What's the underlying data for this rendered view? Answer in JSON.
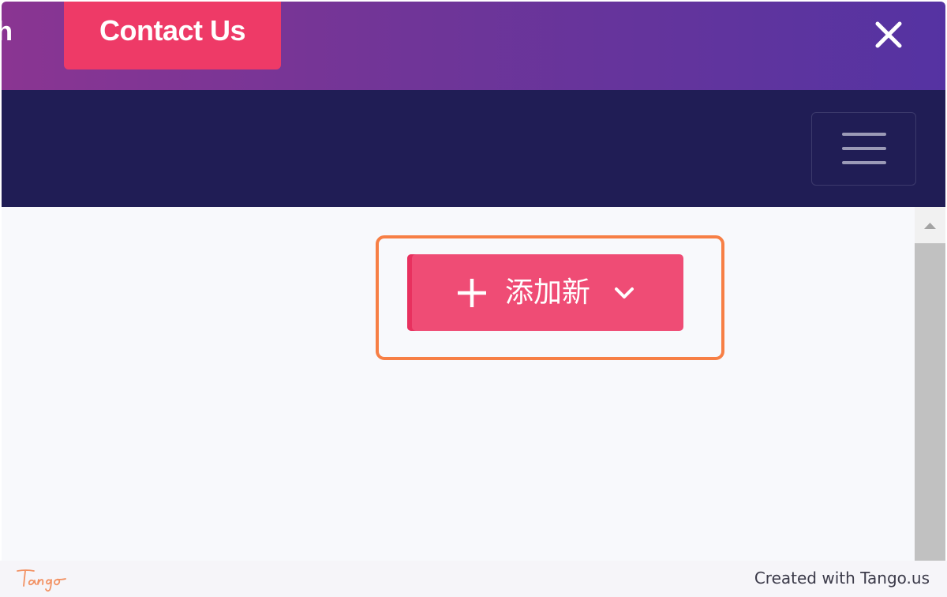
{
  "header": {
    "partial_nav_text": "h",
    "contact_label": "Contact Us",
    "close_icon": "close-icon"
  },
  "navbar": {
    "menu_icon": "hamburger-icon"
  },
  "main": {
    "add_new": {
      "label": "添加新",
      "leading_icon": "plus-icon",
      "trailing_icon": "chevron-down-icon"
    }
  },
  "footer": {
    "logo_text": "Tango",
    "credit": "Created with Tango.us"
  },
  "colors": {
    "accent_pink": "#ee3a67",
    "highlight_orange": "#f77f45",
    "navbar_bg": "#201d55",
    "header_gradient_start": "#8a3592",
    "header_gradient_end": "#5533a2"
  }
}
